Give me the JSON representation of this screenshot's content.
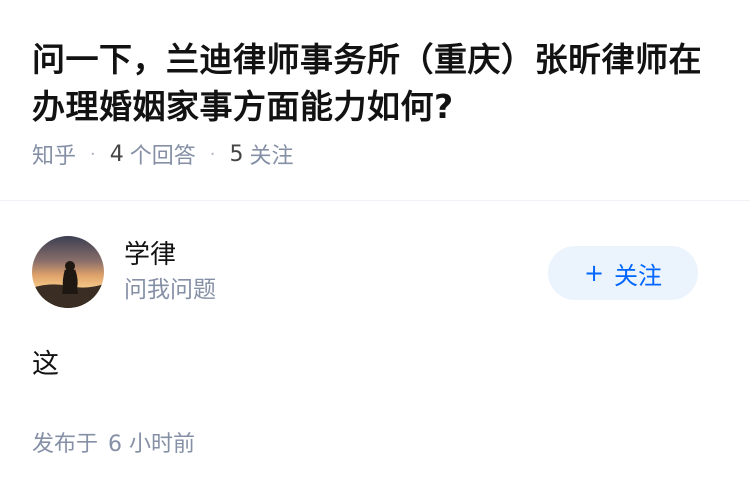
{
  "question": {
    "title": "问一下，兰迪律师事务所（重庆）张昕律师在办理婚姻家事方面能力如何?",
    "source": "知乎",
    "answer_count": "4",
    "answer_label": "个回答",
    "follower_count": "5",
    "follower_label": "关注"
  },
  "answer": {
    "author_name": "学律",
    "author_subtitle": "问我问题",
    "follow_label": "关注",
    "content": "这",
    "published_prefix": "发布于",
    "published_value": "6 小时前"
  },
  "colors": {
    "accent": "#0066ff",
    "button_bg": "#ebf3fc",
    "meta_text": "#8590a6"
  }
}
